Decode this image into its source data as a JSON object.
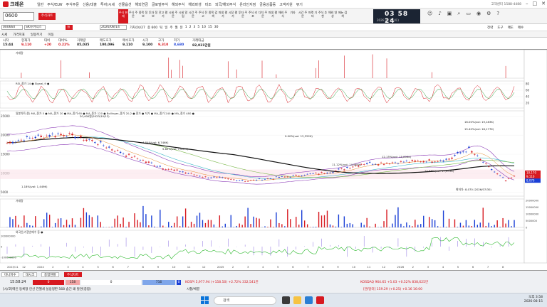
{
  "app": {
    "name": "크레온",
    "menu": [
      "일반",
      "주식/ELW",
      "주식주문",
      "신용/대출",
      "투자/시세",
      "선물옵션",
      "해외연금",
      "글로벌주식",
      "해외주식",
      "해외파생",
      "미조",
      "외국/해외주식",
      "온라인지점",
      "금융상품등",
      "고객지원",
      "뷰기"
    ],
    "support": "1588-4488",
    "window_buttons": [
      "–",
      "□",
      "✕"
    ]
  },
  "toolbar": {
    "code": "0600",
    "red_button": "주식차트",
    "icons": [
      "주식 현재",
      "주식 주문",
      "종목 정보",
      "투자 정보",
      "잔고 평가",
      "시세 주문",
      "시세 알림",
      "시간 주문",
      "주식 잔고",
      "종목 검색",
      "파생 평가",
      "시장 평가",
      "투자 주문",
      "주식 리포",
      "다치 주문",
      "파생 평가",
      "해외 주식",
      "기타",
      "시간 주문",
      "마켓 기타",
      "주식 추천",
      "해외 영상",
      "메뉴 검색"
    ]
  },
  "clock": {
    "time": "03 58 24",
    "date": "2026.08.15 (토)"
  },
  "chart_bar": {
    "code": "000660",
    "name": "SK하이닉스",
    "tab_red": "월",
    "date": "2026/08/14",
    "fields": [
      "가치(0)/27",
      "종 600",
      "틱",
      "일",
      "주",
      "월",
      "분",
      "1",
      "2",
      "3",
      "5",
      "10",
      "15",
      "30"
    ],
    "right": [
      "전략",
      "도구",
      "매도",
      "매수"
    ]
  },
  "row4": [
    "시세",
    "가격지표",
    "일봉주기",
    "이동"
  ],
  "quote": {
    "headers": [
      "시작",
      "현재가",
      "대비",
      "대비%",
      "거래량",
      "매도호가",
      "매수호가",
      "시가",
      "고가",
      "저가",
      "거래대금"
    ],
    "values": [
      "15:44",
      "9,110",
      "+20",
      "0.22%",
      "85,035",
      "100,096",
      "9,110",
      "9,100",
      "9,310",
      "8,680",
      "82,021만원"
    ],
    "up_color": "#d71920",
    "down_color": "#1a3fd6"
  },
  "panels": {
    "p1_legend": "거래량",
    "p2_legend": "RSI_종가 14 ● Signal_9 ●",
    "p3_legend": "일봉차트(원) MA_종가 5 ● MA_종가 20 ● MA_종가 60 ● MA_종가 120 ● Bollinger_종가 20,2 ● 종가 ● 저가 ● MA_종가 240 ● MA_종가 480 ●",
    "p4_legend": "거래량",
    "p5_legend": "외국인/기관순매수 등 ●"
  },
  "annotations": [
    {
      "text": "20,400원(2023/10/12)",
      "rel": "high"
    },
    {
      "text": "16.00%(vol: 19,183K)"
    },
    {
      "text": "15.40%(vol: 18,177K)"
    },
    {
      "text": "9.00%(vol: 12,322K)"
    },
    {
      "text": "4.84%(vol: 6,746K)"
    },
    {
      "text": "5.85%(vol: 7,633K)"
    },
    {
      "text": "12.15%(vol: 15,806K)"
    },
    {
      "text": "11.12%(vol: 14,564K)"
    },
    {
      "text": "14.86%(vol: 17,633K)"
    },
    {
      "text": "1.18%(vol: 1,449K)"
    },
    {
      "text": "최저가: 8,070 (2026/07/30)"
    }
  ],
  "price_axis": [
    "25000",
    "20000",
    "15000",
    "10000",
    "5000"
  ],
  "price_labels": {
    "current": "9,110",
    "hi": "10,170",
    "lo": "8,070"
  },
  "vol_axis": [
    "20000000",
    "15000000",
    "10000000",
    "5000000",
    "0"
  ],
  "rsi_axis": [
    "80",
    "60",
    "40",
    "20"
  ],
  "flow_axis": [
    "100000000",
    "0",
    "-100000000"
  ],
  "x_axis": [
    "2023/11",
    "12",
    "2024",
    "2",
    "3",
    "4",
    "5",
    "6",
    "7",
    "8",
    "9",
    "10",
    "11",
    "12",
    "2025",
    "2",
    "3",
    "4",
    "5",
    "6",
    "7",
    "8",
    "9",
    "10",
    "11",
    "12",
    "2026",
    "2",
    "3",
    "4",
    "5",
    "6",
    "7",
    "8"
  ],
  "bottom": {
    "tabs": [
      "미니지수",
      "대시크",
      "종합현황",
      "주식차트"
    ],
    "time": "15:58:24",
    "counts": [
      "0",
      "158",
      "0",
      "716",
      "0"
    ],
    "kospi": "KOSPI 5,977.94 (+158.50) +2.72% 332,541만",
    "kosdaq": "KOSDAQ 964.65 +5.03 +0.52% 838,625만",
    "ticker": "[시/코]메인 등록형 인선 전월세 실용형판 568 숨긴 왜 발견(종합)",
    "ticker2": "시황/체결",
    "fx": "[엔/달러] 159.29 (+0.25) +0.16 16:00"
  },
  "taskbar": {
    "search": "검색",
    "time": "오후 3:58",
    "date": "2026-08-15"
  }
}
